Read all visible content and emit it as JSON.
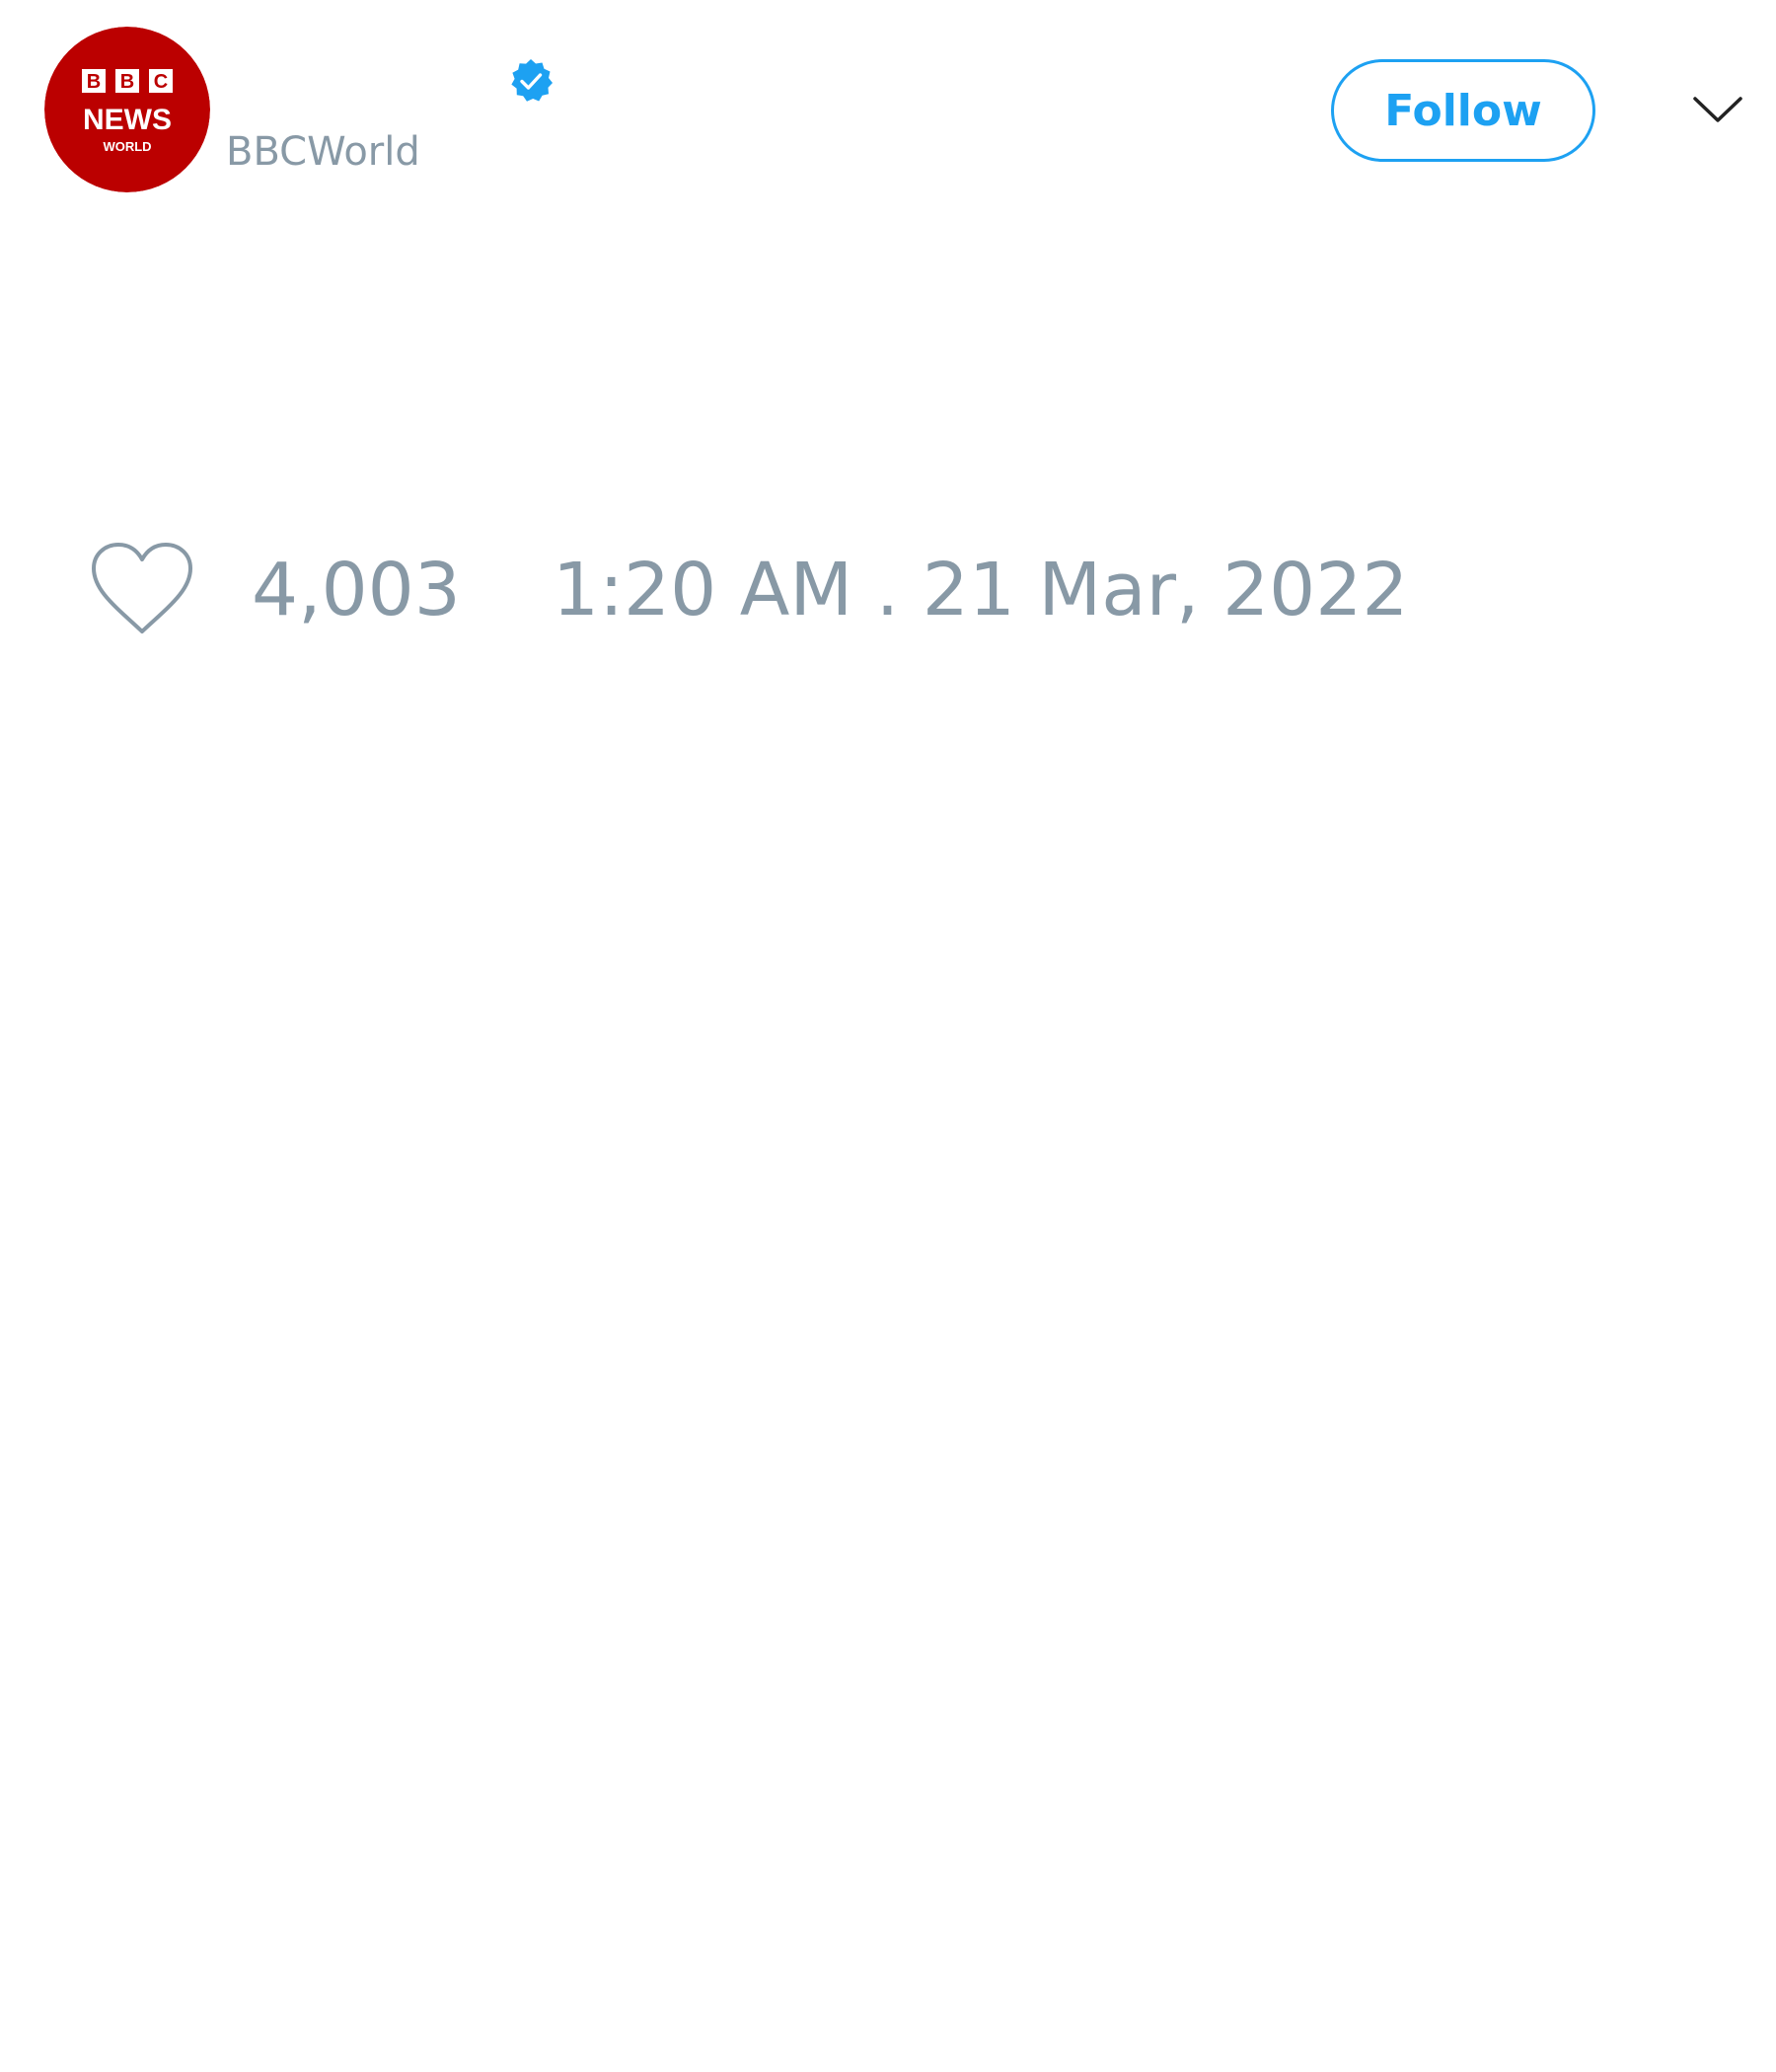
{
  "tweet": {
    "author": {
      "avatar_logo_text": [
        "B",
        "B",
        "C",
        "NEWS",
        "WORLD"
      ],
      "handle": "BBCWorld",
      "verified": true
    },
    "follow_label": "Follow",
    "likes_count": "4,003",
    "timestamp": "1:20 AM . 21 Mar, 2022"
  },
  "icons": {
    "avatar": "bbc-news-world-logo",
    "verified": "verified-badge-icon",
    "menu": "chevron-down-icon",
    "like": "heart-icon"
  },
  "colors": {
    "brand_blue": "#1da1f2",
    "muted_text": "#8899a6",
    "bbc_red": "#bb0000",
    "background": "#ffffff"
  }
}
